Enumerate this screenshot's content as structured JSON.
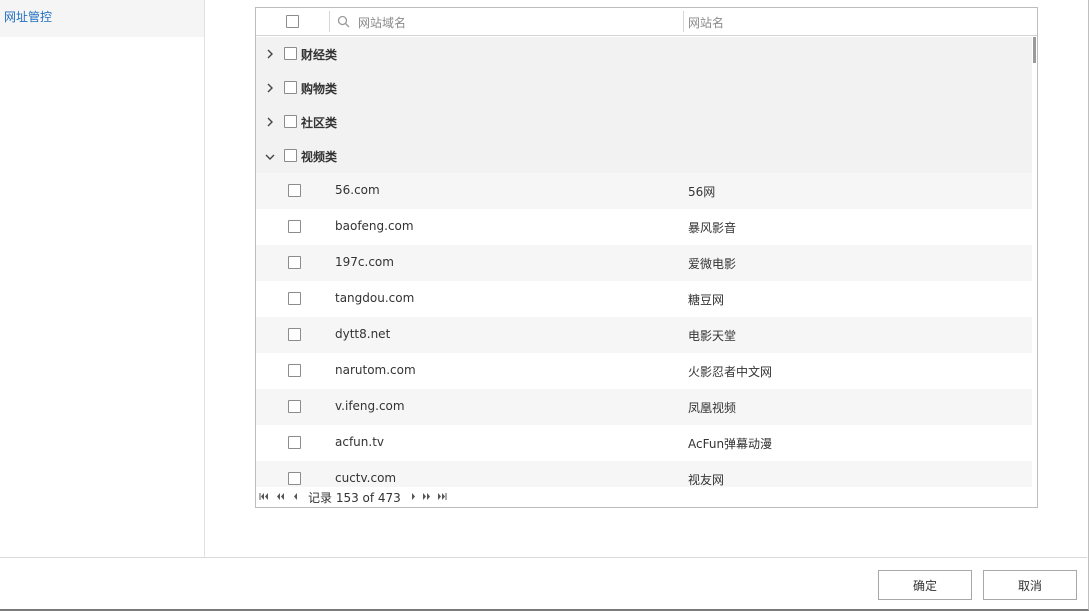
{
  "sidebar": {
    "items": [
      {
        "label": "网址管控"
      }
    ]
  },
  "grid": {
    "columns": {
      "domain_placeholder": "网站域名",
      "name": "网站名"
    },
    "groups": [
      {
        "label": "财经类",
        "expanded": false
      },
      {
        "label": "购物类",
        "expanded": false
      },
      {
        "label": "社区类",
        "expanded": false
      },
      {
        "label": "视频类",
        "expanded": true
      }
    ],
    "rows": [
      {
        "domain": "56.com",
        "name": "56网"
      },
      {
        "domain": "baofeng.com",
        "name": "暴风影音"
      },
      {
        "domain": "197c.com",
        "name": "爱微电影"
      },
      {
        "domain": "tangdou.com",
        "name": "糖豆网"
      },
      {
        "domain": "dytt8.net",
        "name": "电影天堂"
      },
      {
        "domain": "narutom.com",
        "name": "火影忍者中文网"
      },
      {
        "domain": "v.ifeng.com",
        "name": "凤凰视频"
      },
      {
        "domain": "acfun.tv",
        "name": "AcFun弹幕动漫"
      },
      {
        "domain": "cuctv.com",
        "name": "视友网"
      }
    ],
    "pager": {
      "text": "记录 153 of 473"
    }
  },
  "footer": {
    "ok_label": "确定",
    "cancel_label": "取消"
  },
  "colors": {
    "accent": "#1f6fbf",
    "group_bg": "#f2f2f2",
    "border": "#bdbdbd"
  }
}
